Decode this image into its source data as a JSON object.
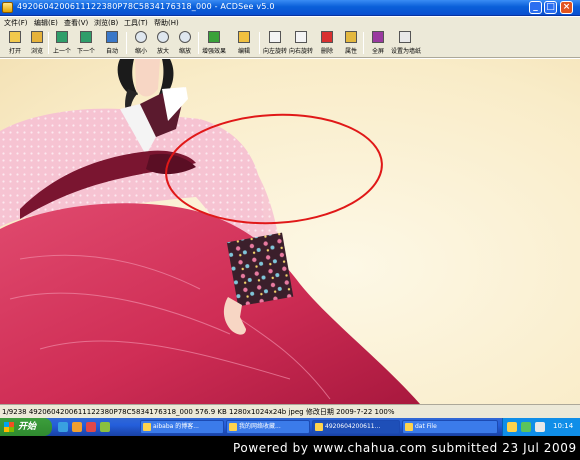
{
  "window": {
    "title": "4920604200611122380P78C5834176318_000 - ACDSee v5.0",
    "buttons": {
      "minimize": "_",
      "maximize": "□",
      "close": "×"
    }
  },
  "menu": [
    "文件(F)",
    "编辑(E)",
    "查看(V)",
    "浏览(B)",
    "工具(T)",
    "帮助(H)"
  ],
  "toolbar": [
    {
      "label": "打开",
      "icon": "open-folder-icon"
    },
    {
      "label": "浏览",
      "icon": "browse-icon"
    },
    {
      "label": "上一个",
      "icon": "previous-icon"
    },
    {
      "label": "下一个",
      "icon": "next-icon"
    },
    {
      "label": "自动",
      "icon": "slideshow-icon"
    },
    {
      "label": "缩小",
      "icon": "zoom-out-icon"
    },
    {
      "label": "放大",
      "icon": "zoom-in-icon"
    },
    {
      "label": "缩放",
      "icon": "zoom-icon"
    },
    {
      "label": "增强效果",
      "icon": "enhance-icon"
    },
    {
      "label": "编辑",
      "icon": "edit-icon"
    },
    {
      "label": "向左旋转",
      "icon": "rotate-left-icon"
    },
    {
      "label": "向右旋转",
      "icon": "rotate-right-icon"
    },
    {
      "label": "删除",
      "icon": "delete-icon"
    },
    {
      "label": "属性",
      "icon": "properties-icon"
    },
    {
      "label": "全屏",
      "icon": "fullscreen-icon"
    },
    {
      "label": "设置为墙纸",
      "icon": "wallpaper-icon"
    }
  ],
  "status": "1/9238   4920604200611122380P78C5834176318_000   576.9 KB   1280x1024x24b jpeg   修改日期 2009-7-22   100%",
  "taskbar": {
    "start": "开始",
    "tasks": [
      "aibaba 的博客...",
      "我的网络收藏...",
      "4920604200611...",
      "dat File"
    ],
    "clock": "10:14"
  },
  "footer": "Powered by www.chahua.com submitted 23 Jul 2009",
  "colors": {
    "skirt": "#d13358",
    "jacket": "#f7c6d4",
    "annotation": "#e01818"
  }
}
